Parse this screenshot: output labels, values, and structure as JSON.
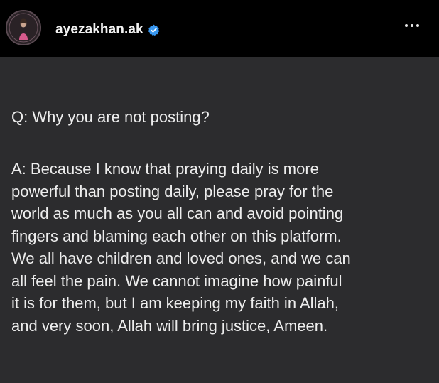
{
  "header": {
    "username": "ayezakhan.ak",
    "verified_icon": "verified-badge-icon",
    "more_icon": "more-options-icon",
    "accent_color": "#3897f0"
  },
  "post": {
    "question": "Q: Why you are not posting?",
    "answer_lines": [
      "A: Because I know that praying daily is more",
      "powerful than posting daily, please pray for the",
      "world as much as you all can and avoid pointing",
      "fingers and blaming each other on this platform.",
      "We all have children and loved ones, and we can",
      "all feel the pain. We cannot imagine how painful",
      "it is for them, but I am keeping my faith in Allah,",
      "and very soon, Allah will bring justice, Ameen."
    ],
    "background_color": "#2c2c2e"
  }
}
